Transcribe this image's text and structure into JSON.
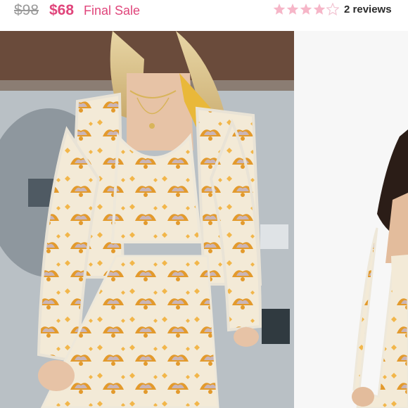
{
  "listing": {
    "original_price": "$98",
    "sale_price": "$68",
    "sale_label": "Final Sale",
    "rating": 4,
    "rating_max": 5,
    "reviews": "2 reviews"
  },
  "colors": {
    "accent": "#e0457b",
    "star_filled": "#f6b6c8",
    "star_empty": "#f2c4d2"
  },
  "gallery": {
    "images": [
      {
        "name": "model-front-photo"
      },
      {
        "name": "model-side-photo"
      }
    ]
  }
}
